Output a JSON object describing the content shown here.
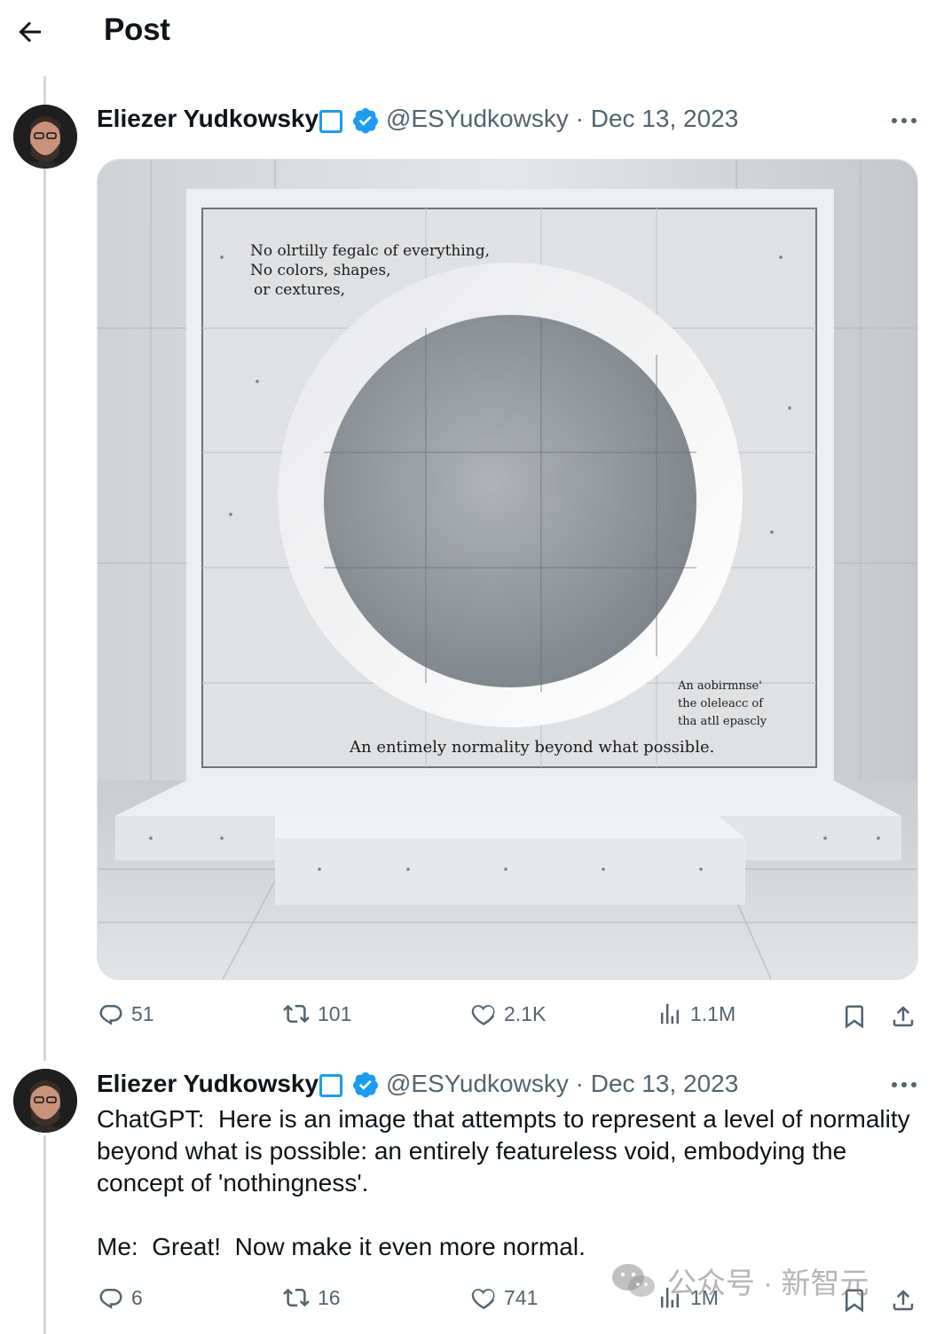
{
  "header": {
    "title": "Post",
    "back_icon": "arrow-left-icon"
  },
  "post": {
    "author": "Eliezer Yudkowsky",
    "handle_date": "@ESYudkowsky · Dec 13, 2023",
    "image_text": {
      "line1": "No olrtilly fegalc of everything,",
      "line2": "No colors, shapes,",
      "line3": "or cextures,",
      "caption": "An entimely  normality beyond what possible.",
      "side1": "An aobirmnse'",
      "side2": "the oleleacc of",
      "side3": "tha atll epascly"
    },
    "stats": {
      "replies": "51",
      "reposts": "101",
      "likes": "2.1K",
      "views": "1.1M"
    }
  },
  "reply": {
    "author": "Eliezer Yudkowsky",
    "handle_date": "@ESYudkowsky · Dec 13, 2023",
    "text": "ChatGPT:  Here is an image that attempts to represent a level of normality beyond what is possible: an entirely featureless void, embodying the concept of 'nothingness'.\n\nMe:  Great!  Now make it even more normal.",
    "stats": {
      "replies": "6",
      "reposts": "16",
      "likes": "741",
      "views": "1M"
    }
  },
  "watermark": {
    "text": "公众号 · 新智元",
    "icon": "wechat-icon"
  },
  "colors": {
    "verified": "#1d9bf0",
    "muted": "#536471",
    "text": "#0f1419"
  }
}
